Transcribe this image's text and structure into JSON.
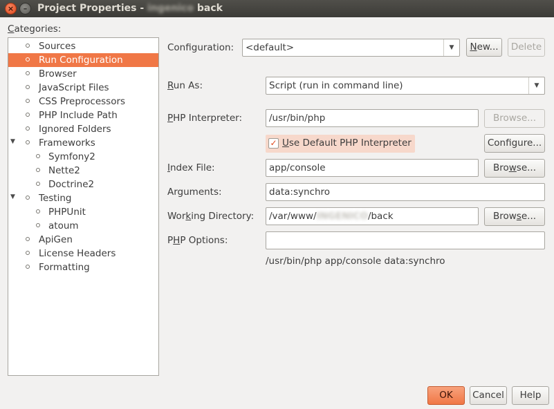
{
  "window": {
    "title_prefix": "Project Properties - ",
    "title_blurred": "ingenico",
    "title_suffix": " back",
    "close_glyph": "×",
    "minimize_glyph": "–"
  },
  "sidebar": {
    "label_u": "C",
    "label_rest": "ategories:",
    "items": [
      {
        "label": "Sources"
      },
      {
        "label": "Run Configuration"
      },
      {
        "label": "Browser"
      },
      {
        "label": "JavaScript Files"
      },
      {
        "label": "CSS Preprocessors"
      },
      {
        "label": "PHP Include Path"
      },
      {
        "label": "Ignored Folders"
      },
      {
        "label": "Frameworks"
      },
      {
        "label": "Symfony2"
      },
      {
        "label": "Nette2"
      },
      {
        "label": "Doctrine2"
      },
      {
        "label": "Testing"
      },
      {
        "label": "PHPUnit"
      },
      {
        "label": "atoum"
      },
      {
        "label": "ApiGen"
      },
      {
        "label": "License Headers"
      },
      {
        "label": "Formatting"
      }
    ],
    "expander_glyph": "▼"
  },
  "form": {
    "configuration": {
      "label": "Configuration:",
      "value": "<default>",
      "new_u": "N",
      "new_rest": "ew...",
      "delete_label": "Delete"
    },
    "run_as": {
      "label_u": "R",
      "label_rest": "un As:",
      "value": "Script (run in command line)"
    },
    "interpreter": {
      "label_u": "P",
      "label_rest": "HP Interpreter:",
      "value": "/usr/bin/php",
      "browse_label": "Browse..."
    },
    "use_default": {
      "check_glyph": "✓",
      "label_u": "U",
      "label_rest": "se Default PHP Interpreter",
      "configure_label": "Configure..."
    },
    "index_file": {
      "label_u": "I",
      "label_rest": "ndex File:",
      "value": "app/console",
      "browse_pre": "Bro",
      "browse_u": "w",
      "browse_post": "se..."
    },
    "arguments": {
      "label": "Arguments:",
      "value": "data:synchro"
    },
    "working_dir": {
      "label_pre": "Wor",
      "label_u": "k",
      "label_post": "ing Directory:",
      "value_pre": "/var/www/",
      "value_blurred": "INGENICO",
      "value_post": "/back",
      "browse_pre": "Brow",
      "browse_u": "s",
      "browse_post": "e..."
    },
    "php_options": {
      "label_pre": "P",
      "label_u": "H",
      "label_post": "P Options:",
      "value": ""
    },
    "command_preview": "/usr/bin/php app/console data:synchro",
    "dropdown_glyph": "▼"
  },
  "footer": {
    "ok_label": "OK",
    "cancel_label": "Cancel",
    "help_label": "Help"
  }
}
